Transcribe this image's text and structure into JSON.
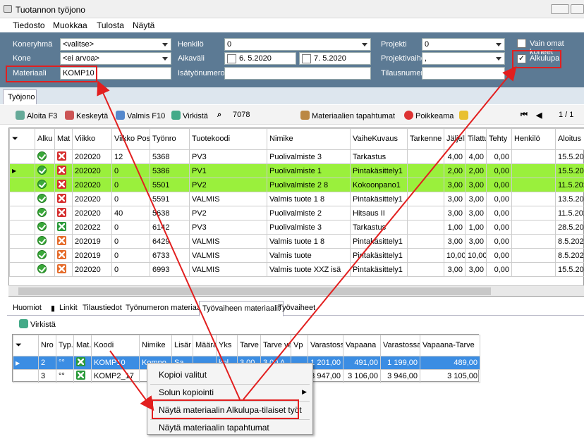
{
  "window": {
    "title": "Tuotannon työjono"
  },
  "menu": [
    "Tiedosto",
    "Muokkaa",
    "Tulosta",
    "Näytä"
  ],
  "filters": {
    "koneryhma_label": "Koneryhmä",
    "koneryhma_value": "<valitse>",
    "kone_label": "Kone",
    "kone_value": "<ei arvoa>",
    "materiaali_label": "Materiaali",
    "materiaali_value": "KOMP10",
    "henkilo_label": "Henkilö",
    "henkilo_value": "0",
    "aikavali_label": "Aikaväli",
    "date_from": "6. 5.2020",
    "date_to": "7. 5.2020",
    "isatyonumero_label": "Isätyönumero",
    "projekti_label": "Projekti",
    "projekti_value": "0",
    "projektivaihe_label": "Projektivaihe",
    "projektivaihe_value": ",",
    "tilausnumero_label": "Tilausnumero",
    "vain_omat_label": "Vain omat koneet",
    "alkulupa_label": "Alkulupa"
  },
  "main_tab": "Työjono",
  "toolbar": {
    "aloita": "Aloita F3",
    "keskeyta": "Keskeytä",
    "valmis": "Valmis F10",
    "virkista": "Virkistä",
    "count": "7078",
    "materiaalien": "Materiaalien tapahtumat",
    "poikkeama": "Poikkeama",
    "page": "1 / 1"
  },
  "main_grid": {
    "headers": [
      "Alku",
      "Mat",
      "Viikko",
      "Viikko Pos",
      "Työnro",
      "Tuotekoodi",
      "Nimike",
      "VaiheKuvaus",
      "Tarkenne",
      "Jäljellä",
      "Tilattu",
      "Tehty",
      "Henkilö",
      "Aloitus"
    ],
    "rows": [
      {
        "mat": "r",
        "green": false,
        "cur": false,
        "c": [
          "202020",
          "12",
          "5368",
          "PV3",
          "Puolivalmiste 3",
          "Tarkastus",
          "",
          "4,00",
          "4,00",
          "0,00",
          "",
          "15.5.2020"
        ]
      },
      {
        "mat": "r",
        "green": true,
        "cur": true,
        "c": [
          "202020",
          "0",
          "5386",
          "PV1",
          "Puolivalmiste 1",
          "Pintakäsittely1",
          "",
          "2,00",
          "2,00",
          "0,00",
          "",
          "15.5.2020"
        ]
      },
      {
        "mat": "r",
        "green": true,
        "cur": false,
        "c": [
          "202020",
          "0",
          "5501",
          "PV2",
          "Puolivalmiste 2 8",
          "Kokoonpano1",
          "",
          "3,00",
          "3,00",
          "0,00",
          "",
          "11.5.2020"
        ]
      },
      {
        "mat": "r",
        "green": false,
        "cur": false,
        "c": [
          "202020",
          "0",
          "5591",
          "VALMIS",
          "Valmis tuote 1 8",
          "Pintakäsittely1",
          "",
          "3,00",
          "3,00",
          "0,00",
          "",
          "13.5.2020"
        ]
      },
      {
        "mat": "r",
        "green": false,
        "cur": false,
        "c": [
          "202020",
          "40",
          "5638",
          "PV2",
          "Puolivalmiste 2",
          "Hitsaus II",
          "",
          "3,00",
          "3,00",
          "0,00",
          "",
          "11.5.2020"
        ]
      },
      {
        "mat": "g",
        "green": false,
        "cur": false,
        "c": [
          "202022",
          "0",
          "6142",
          "PV3",
          "Puolivalmiste 3",
          "Tarkastus",
          "",
          "1,00",
          "1,00",
          "0,00",
          "",
          "28.5.2020"
        ]
      },
      {
        "mat": "o",
        "green": false,
        "cur": false,
        "c": [
          "202019",
          "0",
          "6429",
          "VALMIS",
          "Valmis tuote 1 8",
          "Pintakäsittely1",
          "",
          "3,00",
          "3,00",
          "0,00",
          "",
          "8.5.2020"
        ]
      },
      {
        "mat": "o",
        "green": false,
        "cur": false,
        "c": [
          "202019",
          "0",
          "6733",
          "VALMIS",
          "Valmis tuote",
          "Pintakäsittely1",
          "",
          "10,00",
          "10,00",
          "0,00",
          "",
          "8.5.2020"
        ]
      },
      {
        "mat": "o",
        "green": false,
        "cur": false,
        "c": [
          "202020",
          "0",
          "6993",
          "VALMIS",
          "Valmis tuote XXZ isä",
          "Pintakäsittely1",
          "",
          "3,00",
          "3,00",
          "0,00",
          "",
          "15.5.2020"
        ]
      }
    ]
  },
  "bottom_tabs": [
    "Huomiot",
    "Linkit",
    "Tilaustiedot",
    "Työnumeron materiaalit",
    "Työvaiheen materiaalit",
    "Työvaiheet"
  ],
  "sub_refresh": "Virkistä",
  "mat_grid": {
    "headers": [
      "Nro",
      "Typ.",
      "Mat.",
      "Koodi",
      "Nimike",
      "Lisär",
      "Määrä",
      "Yks",
      "Tarve",
      "Tarve varastoyk",
      "Vp",
      "Varastossa",
      "Vapaana",
      "Varastossa-Tarve",
      "Vapaana-Tarve"
    ],
    "rows": [
      {
        "sel": true,
        "c": [
          "2",
          "",
          "",
          "KOMP10",
          "Kompo",
          "Sa",
          "",
          "kpl",
          "3,00",
          "3,00 A",
          "",
          "1 201,00",
          "491,00",
          "1 199,00",
          "489,00"
        ]
      },
      {
        "sel": false,
        "c": [
          "3",
          "",
          "",
          "KOMP2_17",
          "",
          "",
          "",
          "",
          "",
          "",
          "",
          "3 947,00",
          "3 106,00",
          "3 946,00",
          "3 105,00"
        ]
      }
    ]
  },
  "context_menu": [
    "Kopioi valitut",
    "Solun kopiointi",
    "Näytä materiaalin Alkulupa-tilaiset työt",
    "Näytä materiaalin tapahtumat"
  ]
}
